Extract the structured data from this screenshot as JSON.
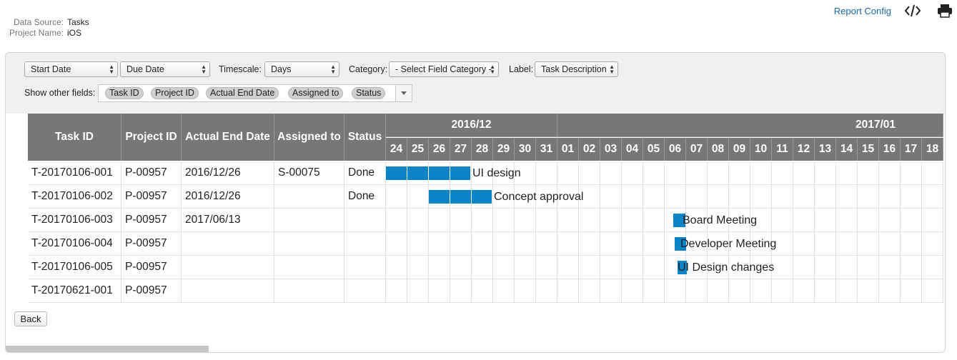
{
  "meta": {
    "data_source_label": "Data Source:",
    "data_source_value": "Tasks",
    "project_name_label": "Project Name:",
    "project_name_value": "iOS"
  },
  "topbar": {
    "report_config": "Report Config",
    "icons": [
      "code-icon",
      "print-icon"
    ]
  },
  "toolbar": {
    "start_select": "Start Date",
    "due_select": "Due Date",
    "timescale_label": "Timescale:",
    "timescale_value": "Days",
    "category_label": "Category:",
    "category_value": "- Select Field Category -",
    "label_label": "Label:",
    "label_value": "Task Description",
    "show_fields_label": "Show other fields:",
    "chips": [
      "Task ID",
      "Project ID",
      "Actual End Date",
      "Assigned to",
      "Status"
    ]
  },
  "table": {
    "columns": [
      "Task ID",
      "Project ID",
      "Actual End Date",
      "Assigned to",
      "Status"
    ],
    "months": [
      "2016/12",
      "2017/01"
    ],
    "days": [
      "24",
      "25",
      "26",
      "27",
      "28",
      "29",
      "30",
      "31",
      "01",
      "02",
      "03",
      "04",
      "05",
      "06",
      "07",
      "08",
      "09",
      "10",
      "11",
      "12",
      "13",
      "14",
      "15",
      "16",
      "17",
      "18"
    ],
    "rows": [
      {
        "task_id": "T-20170106-001",
        "project_id": "P-00957",
        "actual_end": "2016/12/26",
        "assigned": "S-00075",
        "status": "Done",
        "label": "UI design"
      },
      {
        "task_id": "T-20170106-002",
        "project_id": "P-00957",
        "actual_end": "2016/12/26",
        "assigned": "",
        "status": "Done",
        "label": "Concept approval"
      },
      {
        "task_id": "T-20170106-003",
        "project_id": "P-00957",
        "actual_end": "2017/06/13",
        "assigned": "",
        "status": "",
        "label": "Board Meeting"
      },
      {
        "task_id": "T-20170106-004",
        "project_id": "P-00957",
        "actual_end": "",
        "assigned": "",
        "status": "",
        "label": "Developer Meeting"
      },
      {
        "task_id": "T-20170106-005",
        "project_id": "P-00957",
        "actual_end": "",
        "assigned": "",
        "status": "",
        "label": "UI Design changes"
      },
      {
        "task_id": "T-20170621-001",
        "project_id": "P-00957",
        "actual_end": "",
        "assigned": "",
        "status": "",
        "label": ""
      }
    ]
  },
  "gantt_bars": [
    {
      "task": "T-20170106-001",
      "start": "2016-12-24",
      "end": "2016-12-27"
    },
    {
      "task": "T-20170106-002",
      "start": "2016-12-26",
      "end": "2016-12-28"
    },
    {
      "task": "T-20170106-003",
      "start": "2017-01-06",
      "end": "2017-01-06"
    },
    {
      "task": "T-20170106-004",
      "start": "2017-01-06",
      "end": "2017-01-06"
    },
    {
      "task": "T-20170106-005",
      "start": "2017-01-06",
      "end": "2017-01-06"
    }
  ],
  "footer": {
    "back": "Back"
  },
  "colors": {
    "header_bg": "#777777",
    "bar": "#0a84c6",
    "link": "#1a6aa8",
    "toolbar_bg": "#f0f0f0"
  }
}
